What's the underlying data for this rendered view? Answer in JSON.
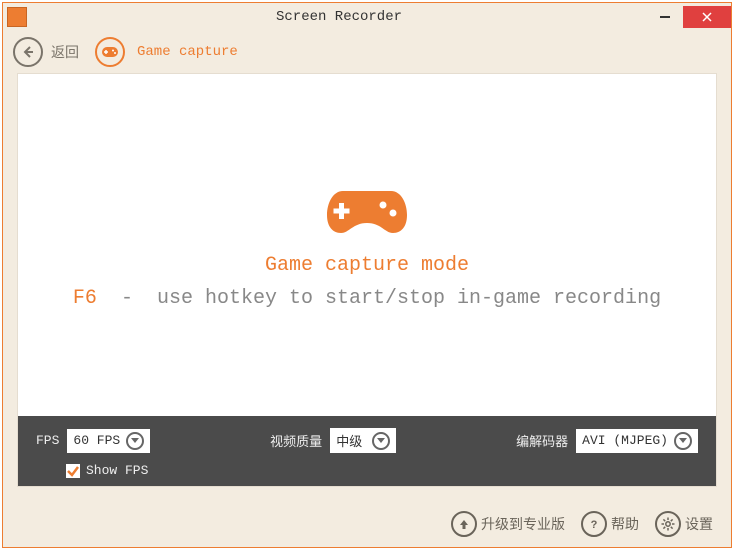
{
  "title": "Screen Recorder",
  "toolbar": {
    "back_label": "返回",
    "section_label": "Game capture"
  },
  "main": {
    "mode_title": "Game capture mode",
    "hotkey": "F6",
    "separator": "-",
    "hotkey_hint": "use hotkey to start/stop in-game recording"
  },
  "settings": {
    "fps_label": "FPS",
    "fps_value": "60 FPS",
    "quality_label": "视频质量",
    "quality_value": "中级",
    "codec_label": "编解码器",
    "codec_value": "AVI (MJPEG)",
    "show_fps_checked": true,
    "show_fps_label": "Show FPS"
  },
  "footer": {
    "upgrade_label": "升级到专业版",
    "help_label": "帮助",
    "settings_label": "设置"
  }
}
